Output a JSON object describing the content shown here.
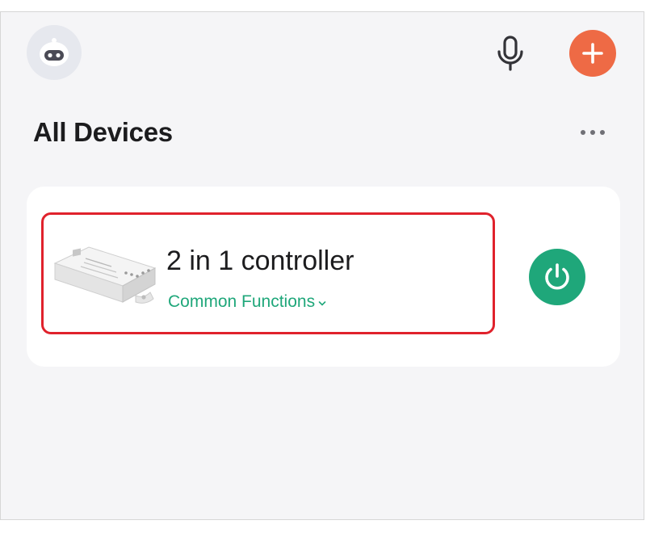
{
  "header": {
    "avatar_icon": "robot-avatar-icon",
    "mic_icon": "microphone-icon",
    "add_icon": "plus-icon"
  },
  "section": {
    "title": "All Devices",
    "more_icon": "more-dots-icon"
  },
  "devices": [
    {
      "name": "2 in 1 controller",
      "functions_label": "Common Functions",
      "functions_icon": "chevron-down-icon",
      "power_icon": "power-icon",
      "power_on": true,
      "highlighted": true
    }
  ],
  "colors": {
    "add_button": "#ee6a45",
    "accent_green": "#1fa77a",
    "highlight_border": "#e0222c",
    "page_background": "#f5f5f7",
    "card_background": "#ffffff"
  }
}
